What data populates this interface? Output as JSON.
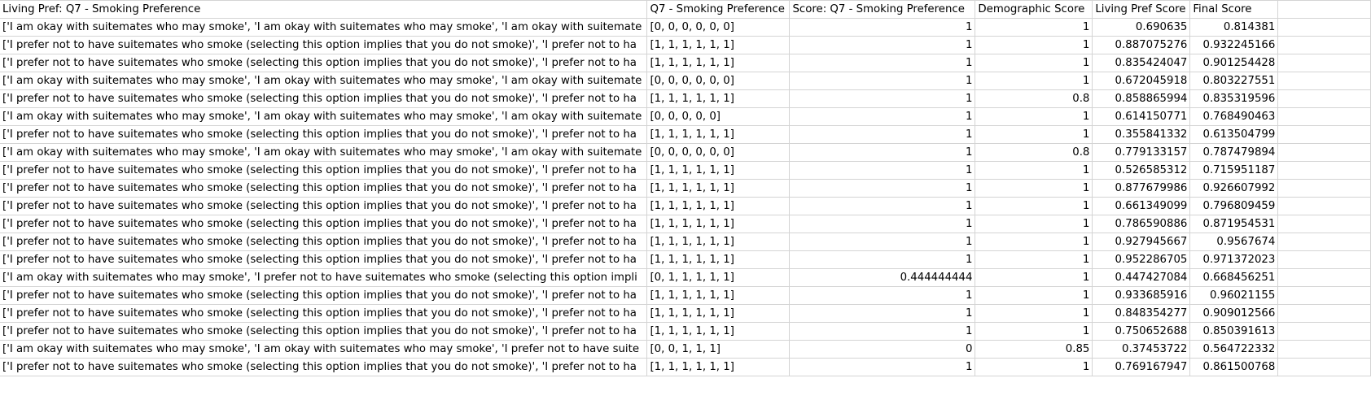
{
  "sheet": {
    "headers": [
      "Living Pref: Q7 - Smoking Preference",
      "Q7 - Smoking Preference",
      "Score: Q7 - Smoking Preference",
      "Demographic Score",
      "Living Pref Score",
      "Final Score"
    ],
    "rows": [
      [
        "['I am okay with suitemates who may smoke', 'I am okay with suitemates who may smoke', 'I am okay with suitemate",
        "[0, 0, 0, 0, 0, 0]",
        "1",
        "1",
        "0.690635",
        "0.814381"
      ],
      [
        "['I prefer not to have suitemates who smoke (selecting this option implies that you do not smoke)', 'I prefer not to ha",
        "[1, 1, 1, 1, 1, 1]",
        "1",
        "1",
        "0.887075276",
        "0.932245166"
      ],
      [
        "['I prefer not to have suitemates who smoke (selecting this option implies that you do not smoke)', 'I prefer not to ha",
        "[1, 1, 1, 1, 1, 1]",
        "1",
        "1",
        "0.835424047",
        "0.901254428"
      ],
      [
        "['I am okay with suitemates who may smoke', 'I am okay with suitemates who may smoke', 'I am okay with suitemate",
        "[0, 0, 0, 0, 0, 0]",
        "1",
        "1",
        "0.672045918",
        "0.803227551"
      ],
      [
        "['I prefer not to have suitemates who smoke (selecting this option implies that you do not smoke)', 'I prefer not to ha",
        "[1, 1, 1, 1, 1, 1]",
        "1",
        "0.8",
        "0.858865994",
        "0.835319596"
      ],
      [
        "['I am okay with suitemates who may smoke', 'I am okay with suitemates who may smoke', 'I am okay with suitemate",
        "[0, 0, 0, 0, 0]",
        "1",
        "1",
        "0.614150771",
        "0.768490463"
      ],
      [
        "['I prefer not to have suitemates who smoke (selecting this option implies that you do not smoke)', 'I prefer not to ha",
        "[1, 1, 1, 1, 1, 1]",
        "1",
        "1",
        "0.355841332",
        "0.613504799"
      ],
      [
        "['I am okay with suitemates who may smoke', 'I am okay with suitemates who may smoke', 'I am okay with suitemate",
        "[0, 0, 0, 0, 0, 0]",
        "1",
        "0.8",
        "0.779133157",
        "0.787479894"
      ],
      [
        "['I prefer not to have suitemates who smoke (selecting this option implies that you do not smoke)', 'I prefer not to ha",
        "[1, 1, 1, 1, 1, 1]",
        "1",
        "1",
        "0.526585312",
        "0.715951187"
      ],
      [
        "['I prefer not to have suitemates who smoke (selecting this option implies that you do not smoke)', 'I prefer not to ha",
        "[1, 1, 1, 1, 1, 1]",
        "1",
        "1",
        "0.877679986",
        "0.926607992"
      ],
      [
        "['I prefer not to have suitemates who smoke (selecting this option implies that you do not smoke)', 'I prefer not to ha",
        "[1, 1, 1, 1, 1, 1]",
        "1",
        "1",
        "0.661349099",
        "0.796809459"
      ],
      [
        "['I prefer not to have suitemates who smoke (selecting this option implies that you do not smoke)', 'I prefer not to ha",
        "[1, 1, 1, 1, 1, 1]",
        "1",
        "1",
        "0.786590886",
        "0.871954531"
      ],
      [
        "['I prefer not to have suitemates who smoke (selecting this option implies that you do not smoke)', 'I prefer not to ha",
        "[1, 1, 1, 1, 1, 1]",
        "1",
        "1",
        "0.927945667",
        "0.9567674"
      ],
      [
        "['I prefer not to have suitemates who smoke (selecting this option implies that you do not smoke)', 'I prefer not to ha",
        "[1, 1, 1, 1, 1, 1]",
        "1",
        "1",
        "0.952286705",
        "0.971372023"
      ],
      [
        "['I am okay with suitemates who may smoke', 'I prefer not to have suitemates who smoke (selecting this option impli",
        "[0, 1, 1, 1, 1, 1]",
        "0.444444444",
        "1",
        "0.447427084",
        "0.668456251"
      ],
      [
        "['I prefer not to have suitemates who smoke (selecting this option implies that you do not smoke)', 'I prefer not to ha",
        "[1, 1, 1, 1, 1, 1]",
        "1",
        "1",
        "0.933685916",
        "0.96021155"
      ],
      [
        "['I prefer not to have suitemates who smoke (selecting this option implies that you do not smoke)', 'I prefer not to ha",
        "[1, 1, 1, 1, 1, 1]",
        "1",
        "1",
        "0.848354277",
        "0.909012566"
      ],
      [
        "['I prefer not to have suitemates who smoke (selecting this option implies that you do not smoke)', 'I prefer not to ha",
        "[1, 1, 1, 1, 1, 1]",
        "1",
        "1",
        "0.750652688",
        "0.850391613"
      ],
      [
        "['I am okay with suitemates who may smoke', 'I am okay with suitemates who may smoke', 'I prefer not to have suite",
        "[0, 0, 1, 1, 1]",
        "0",
        "0.85",
        "0.37453722",
        "0.564722332"
      ],
      [
        "['I prefer not to have suitemates who smoke (selecting this option implies that you do not smoke)', 'I prefer not to ha",
        "[1, 1, 1, 1, 1, 1]",
        "1",
        "1",
        "0.769167947",
        "0.861500768"
      ]
    ]
  }
}
